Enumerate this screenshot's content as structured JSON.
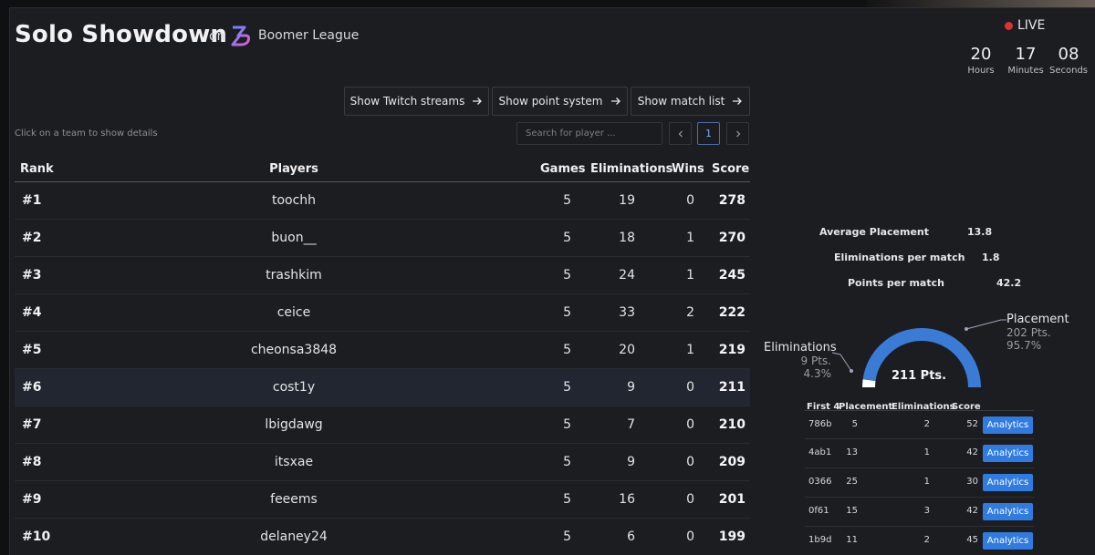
{
  "header": {
    "title": "Solo Showdown",
    "on_text": "on",
    "league_name": "Boomer League",
    "live_label": "LIVE",
    "countdown": [
      {
        "value": "20",
        "label": "Hours"
      },
      {
        "value": "17",
        "label": "Minutes"
      },
      {
        "value": "08",
        "label": "Seconds"
      }
    ]
  },
  "toolbar": {
    "twitch_label": "Show Twitch streams",
    "points_label": "Show point system",
    "matches_label": "Show match list"
  },
  "controls": {
    "hint": "Click on a team to show details",
    "search_placeholder": "Search for player ...",
    "page_current": "1"
  },
  "leaderboard": {
    "columns": {
      "rank": "Rank",
      "players": "Players",
      "games": "Games",
      "eliminations": "Eliminations",
      "wins": "Wins",
      "score": "Score"
    },
    "rows": [
      {
        "rank": "#1",
        "player": "toochh",
        "games": "5",
        "eliminations": "19",
        "wins": "0",
        "score": "278"
      },
      {
        "rank": "#2",
        "player": "buon__",
        "games": "5",
        "eliminations": "18",
        "wins": "1",
        "score": "270"
      },
      {
        "rank": "#3",
        "player": "trashkim",
        "games": "5",
        "eliminations": "24",
        "wins": "1",
        "score": "245"
      },
      {
        "rank": "#4",
        "player": "ceice",
        "games": "5",
        "eliminations": "33",
        "wins": "2",
        "score": "222"
      },
      {
        "rank": "#5",
        "player": "cheonsa3848",
        "games": "5",
        "eliminations": "20",
        "wins": "1",
        "score": "219"
      },
      {
        "rank": "#6",
        "player": "cost1y",
        "games": "5",
        "eliminations": "9",
        "wins": "0",
        "score": "211"
      },
      {
        "rank": "#7",
        "player": "lbigdawg",
        "games": "5",
        "eliminations": "7",
        "wins": "0",
        "score": "210"
      },
      {
        "rank": "#8",
        "player": "itsxae",
        "games": "5",
        "eliminations": "9",
        "wins": "0",
        "score": "209"
      },
      {
        "rank": "#9",
        "player": "feeems",
        "games": "5",
        "eliminations": "16",
        "wins": "0",
        "score": "201"
      },
      {
        "rank": "#10",
        "player": "delaney24",
        "games": "5",
        "eliminations": "6",
        "wins": "0",
        "score": "199"
      }
    ],
    "highlighted_rank": "#6"
  },
  "details": {
    "stats": [
      {
        "label": "Average Placement",
        "value": "13.8"
      },
      {
        "label": "Eliminations per match",
        "value": "1.8"
      },
      {
        "label": "Points per match",
        "value": "42.2"
      }
    ],
    "gauge": {
      "total": "211 Pts.",
      "placement": {
        "label": "Placement",
        "points": "202 Pts.",
        "percent": "95.7%",
        "fraction": 0.957
      },
      "eliminations": {
        "label": "Eliminations",
        "points": "9 Pts.",
        "percent": "4.3%",
        "fraction": 0.043
      },
      "colors": {
        "placement": "#3a7bd5",
        "eliminations": "#ffffff"
      }
    },
    "matches": {
      "columns": {
        "first4": "First 4",
        "placement": "Placement",
        "eliminations": "Eliminations",
        "score": "Score"
      },
      "button_label": "Analytics",
      "rows": [
        {
          "first4": "786b",
          "placement": "5",
          "eliminations": "2",
          "score": "52"
        },
        {
          "first4": "4ab1",
          "placement": "13",
          "eliminations": "1",
          "score": "42"
        },
        {
          "first4": "0366",
          "placement": "25",
          "eliminations": "1",
          "score": "30"
        },
        {
          "first4": "0f61",
          "placement": "15",
          "eliminations": "3",
          "score": "42"
        },
        {
          "first4": "1b9d",
          "placement": "11",
          "eliminations": "2",
          "score": "45"
        }
      ]
    }
  }
}
